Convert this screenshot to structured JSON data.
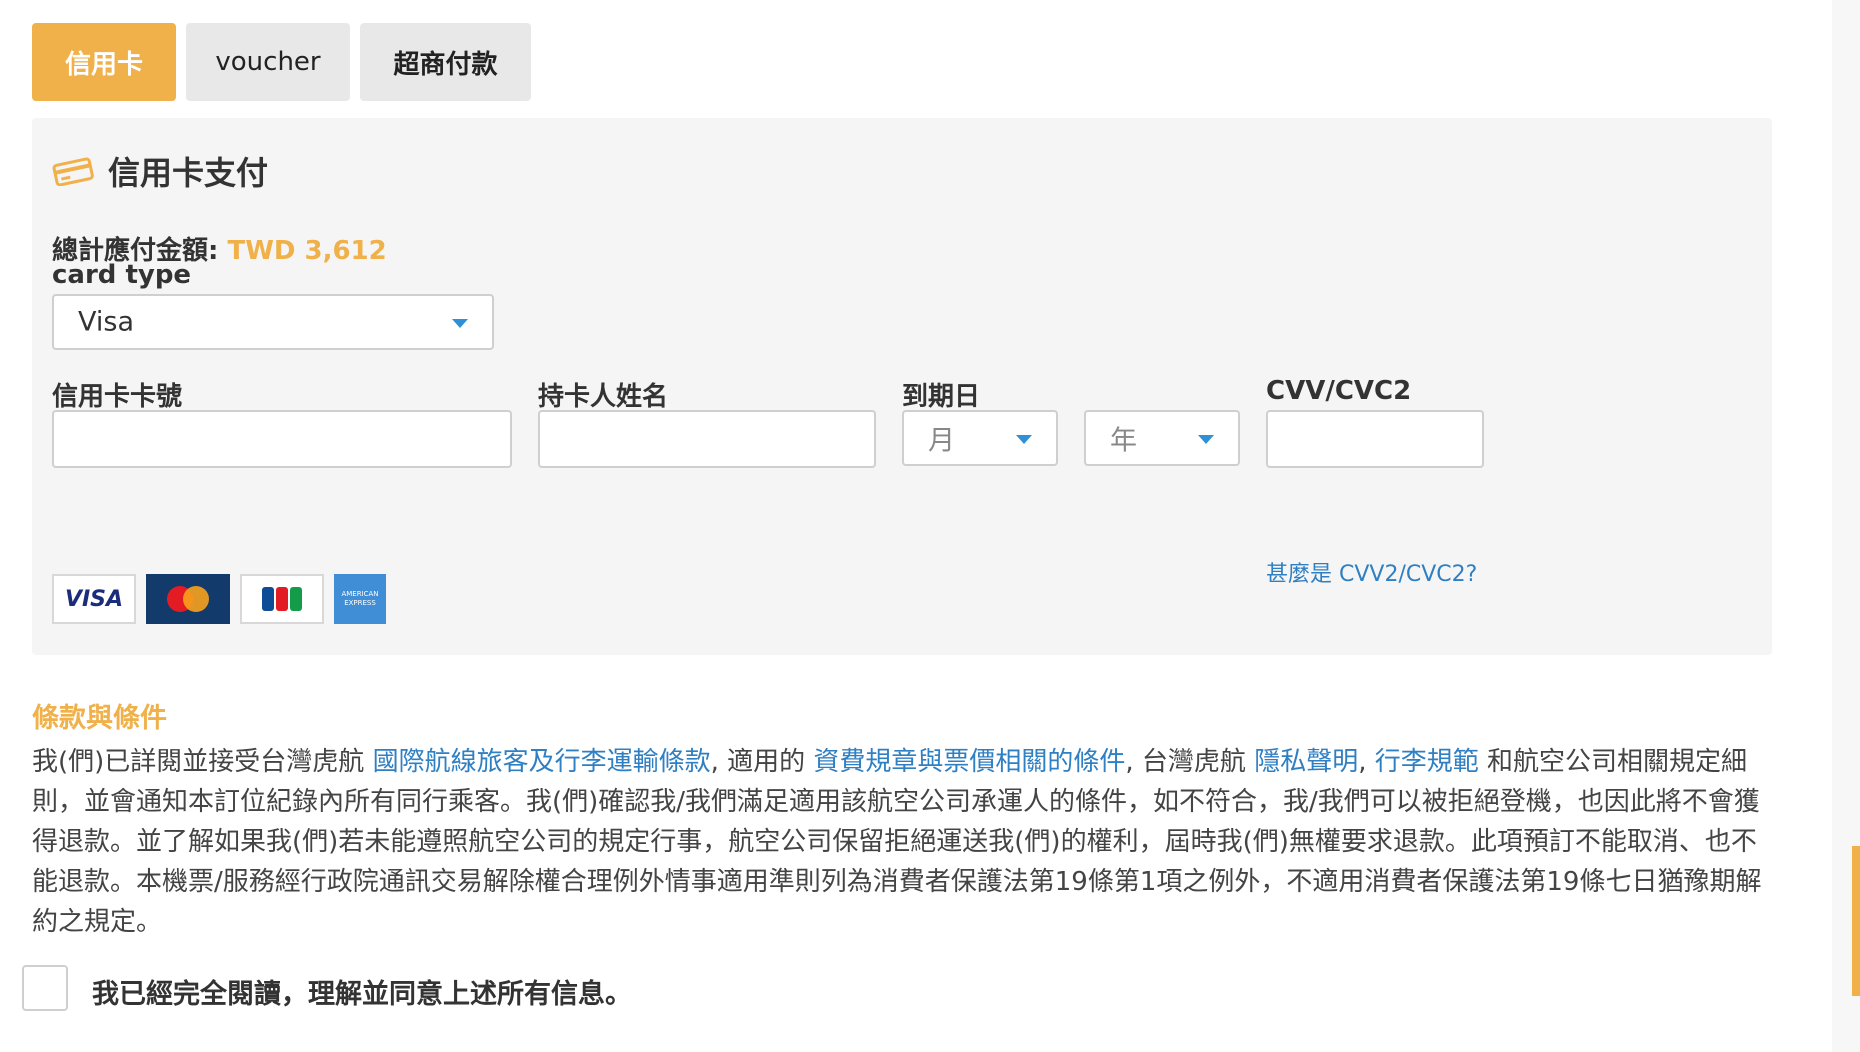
{
  "tabs": {
    "credit_card": "信用卡",
    "voucher": "voucher",
    "convenience_store": "超商付款"
  },
  "panel": {
    "title": "信用卡支付",
    "total_label": "總計應付金額: ",
    "total_amount": "TWD 3,612"
  },
  "card_type": {
    "label": "card type",
    "selected": "Visa"
  },
  "fields": {
    "card_number_label": "信用卡卡號",
    "holder_name_label": "持卡人姓名",
    "expiry_label": "到期日",
    "month_placeholder": "月",
    "year_placeholder": "年",
    "cvv_label": "CVV/CVC2",
    "cvv_help_link": "甚麼是 CVV2/CVC2?"
  },
  "card_logos": {
    "visa": "VISA",
    "amex": "AMERICAN EXPRESS"
  },
  "terms": {
    "title": "條款與條件",
    "t1": "我(們)已詳閱並接受台灣虎航 ",
    "link_carriage": "國際航線旅客及行李運輸條款",
    "t2": ", 適用的 ",
    "link_fare": "資費規章與票價相關的條件",
    "t3": ", 台灣虎航 ",
    "link_privacy": "隱私聲明",
    "t4": ", ",
    "link_baggage": "行李規範",
    "t5": " 和航空公司相關規定細則，並會通知本訂位紀錄內所有同行乘客。我(們)確認我/我們滿足適用該航空公司承運人的條件，如不符合，我/我們可以被拒絕登機，也因此將不會獲得退款。並了解如果我(們)若未能遵照航空公司的規定行事，航空公司保留拒絕運送我(們)的權利，屆時我(們)無權要求退款。此項預訂不能取消、也不能退款。本機票/服務經行政院通訊交易解除權合理例外情事適用準則列為消費者保護法第19條第1項之例外，不適用消費者保護法第19條七日猶豫期解約之規定。",
    "agree_text": "我已經完全閱讀，理解並同意上述所有信息。"
  },
  "colors": {
    "accent": "#f0b04a",
    "link": "#2f7fc3",
    "caret": "#2f90d6"
  }
}
